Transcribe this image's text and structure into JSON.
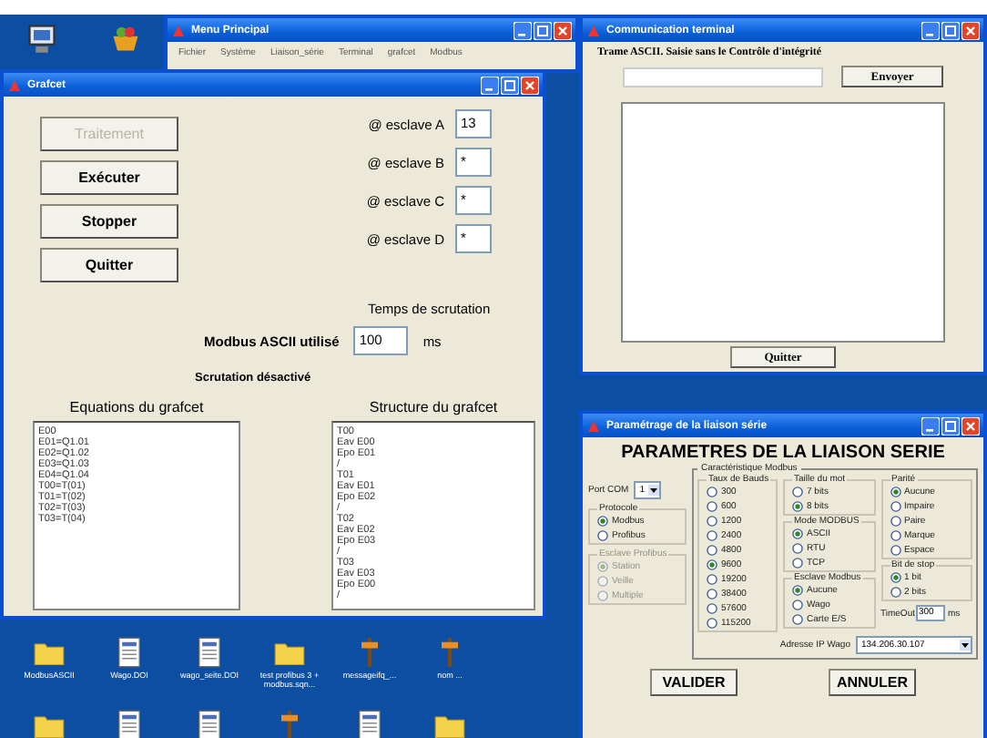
{
  "menu_window": {
    "title": "Menu Principal",
    "menu": [
      "Fichier",
      "Système",
      "Liaison_série",
      "Terminal",
      "grafcet",
      "Modbus"
    ]
  },
  "grafcet_window": {
    "title": "Grafcet",
    "buttons": [
      {
        "label": "Traitement",
        "disabled": true
      },
      {
        "label": "Exécuter",
        "disabled": false
      },
      {
        "label": "Stopper",
        "disabled": false
      },
      {
        "label": "Quitter",
        "disabled": false
      }
    ],
    "slaves": [
      {
        "label": "@ esclave A",
        "value": "13"
      },
      {
        "label": "@ esclave B",
        "value": "*"
      },
      {
        "label": "@ esclave C",
        "value": "*"
      },
      {
        "label": "@ esclave D",
        "value": "*"
      }
    ],
    "scan_time_label": "Temps de scrutation",
    "protocol_label": "Modbus ASCII utilisé",
    "scan_value": "100",
    "scan_unit": "ms",
    "scan_status": "Scrutation désactivé",
    "lists": [
      {
        "title": "Equations du grafcet",
        "lines": [
          "E00",
          "E01=Q1.01",
          "E02=Q1.02",
          "E03=Q1.03",
          "E04=Q1.04",
          "T00=T(01)",
          "T01=T(02)",
          "T02=T(03)",
          "T03=T(04)"
        ]
      },
      {
        "title": "Structure du grafcet",
        "lines": [
          "T00",
          "Eav E00",
          "Epo E01",
          "/",
          "T01",
          "Eav E01",
          "Epo E02",
          "/",
          "T02",
          "Eav E02",
          "Epo E03",
          "/",
          "T03",
          "Eav E03",
          "Epo E00",
          "/"
        ]
      }
    ]
  },
  "terminal_window": {
    "title": "Communication terminal",
    "label": "Trame ASCII. Saisie sans le Contrôle d'intégrité",
    "send_button": "Envoyer",
    "quit_button": "Quitter"
  },
  "serial_window": {
    "title": "Paramétrage de la liaison série",
    "heading": "PARAMETRES DE LA LIAISON SERIE",
    "port": {
      "label": "Port COM",
      "value": "1"
    },
    "left_groups": [
      {
        "legend": "Protocole",
        "disabled": false,
        "options": [
          {
            "label": "Modbus",
            "selected": true
          },
          {
            "label": "Profibus",
            "selected": false
          }
        ]
      },
      {
        "legend": "Esclave Profibus",
        "disabled": true,
        "options": [
          {
            "label": "Station",
            "selected": true
          },
          {
            "label": "Veille",
            "selected": false
          },
          {
            "label": "Multiple",
            "selected": false
          }
        ]
      }
    ],
    "modbus_legend": "Caractéristique Modbus",
    "columns": [
      [
        {
          "legend": "Taux de Bauds",
          "disabled": false,
          "options": [
            {
              "label": "300",
              "selected": false
            },
            {
              "label": "600",
              "selected": false
            },
            {
              "label": "1200",
              "selected": false
            },
            {
              "label": "2400",
              "selected": false
            },
            {
              "label": "4800",
              "selected": false
            },
            {
              "label": "9600",
              "selected": true
            },
            {
              "label": "19200",
              "selected": false
            },
            {
              "label": "38400",
              "selected": false
            },
            {
              "label": "57600",
              "selected": false
            },
            {
              "label": "115200",
              "selected": false
            }
          ]
        }
      ],
      [
        {
          "legend": "Taille du mot",
          "disabled": false,
          "options": [
            {
              "label": "7 bits",
              "selected": false
            },
            {
              "label": "8 bits",
              "selected": true
            }
          ]
        },
        {
          "legend": "Mode MODBUS",
          "disabled": false,
          "options": [
            {
              "label": "ASCII",
              "selected": true
            },
            {
              "label": "RTU",
              "selected": false
            },
            {
              "label": "TCP",
              "selected": false
            }
          ]
        },
        {
          "legend": "Esclave Modbus",
          "disabled": false,
          "options": [
            {
              "label": "Aucune",
              "selected": true
            },
            {
              "label": "Wago",
              "selected": false
            },
            {
              "label": "Carte E/S",
              "selected": false
            }
          ]
        }
      ],
      [
        {
          "legend": "Parité",
          "disabled": false,
          "options": [
            {
              "label": "Aucune",
              "selected": true
            },
            {
              "label": "Impaire",
              "selected": false
            },
            {
              "label": "Paire",
              "selected": false
            },
            {
              "label": "Marque",
              "selected": false
            },
            {
              "label": "Espace",
              "selected": false
            }
          ]
        },
        {
          "legend": "Bit de stop",
          "disabled": false,
          "options": [
            {
              "label": "1 bit",
              "selected": true
            },
            {
              "label": "2 bits",
              "selected": false
            }
          ]
        }
      ]
    ],
    "timeout": {
      "label": "TimeOut",
      "value": "300",
      "unit": "ms"
    },
    "ip": {
      "label": "Adresse IP Wago",
      "value": "134.206.30.107"
    },
    "buttons": [
      "VALIDER",
      "ANNULER"
    ]
  },
  "desktop_icons": [
    {
      "label": "ModbusASCII",
      "kind": "folder"
    },
    {
      "label": "Wago.DOI",
      "kind": "document"
    },
    {
      "label": "wago_seite.DOI",
      "kind": "document"
    },
    {
      "label": "test profibus 3 + modbus.sqn...",
      "kind": "folder"
    },
    {
      "label": "messageifq_...",
      "kind": "tool"
    },
    {
      "label": "nom ...",
      "kind": "tool"
    }
  ],
  "desktop_icons_bottom": [
    {
      "kind": "folder"
    },
    {
      "kind": "document"
    },
    {
      "kind": "document"
    },
    {
      "kind": "tool"
    },
    {
      "kind": "document"
    },
    {
      "kind": "folder"
    }
  ]
}
